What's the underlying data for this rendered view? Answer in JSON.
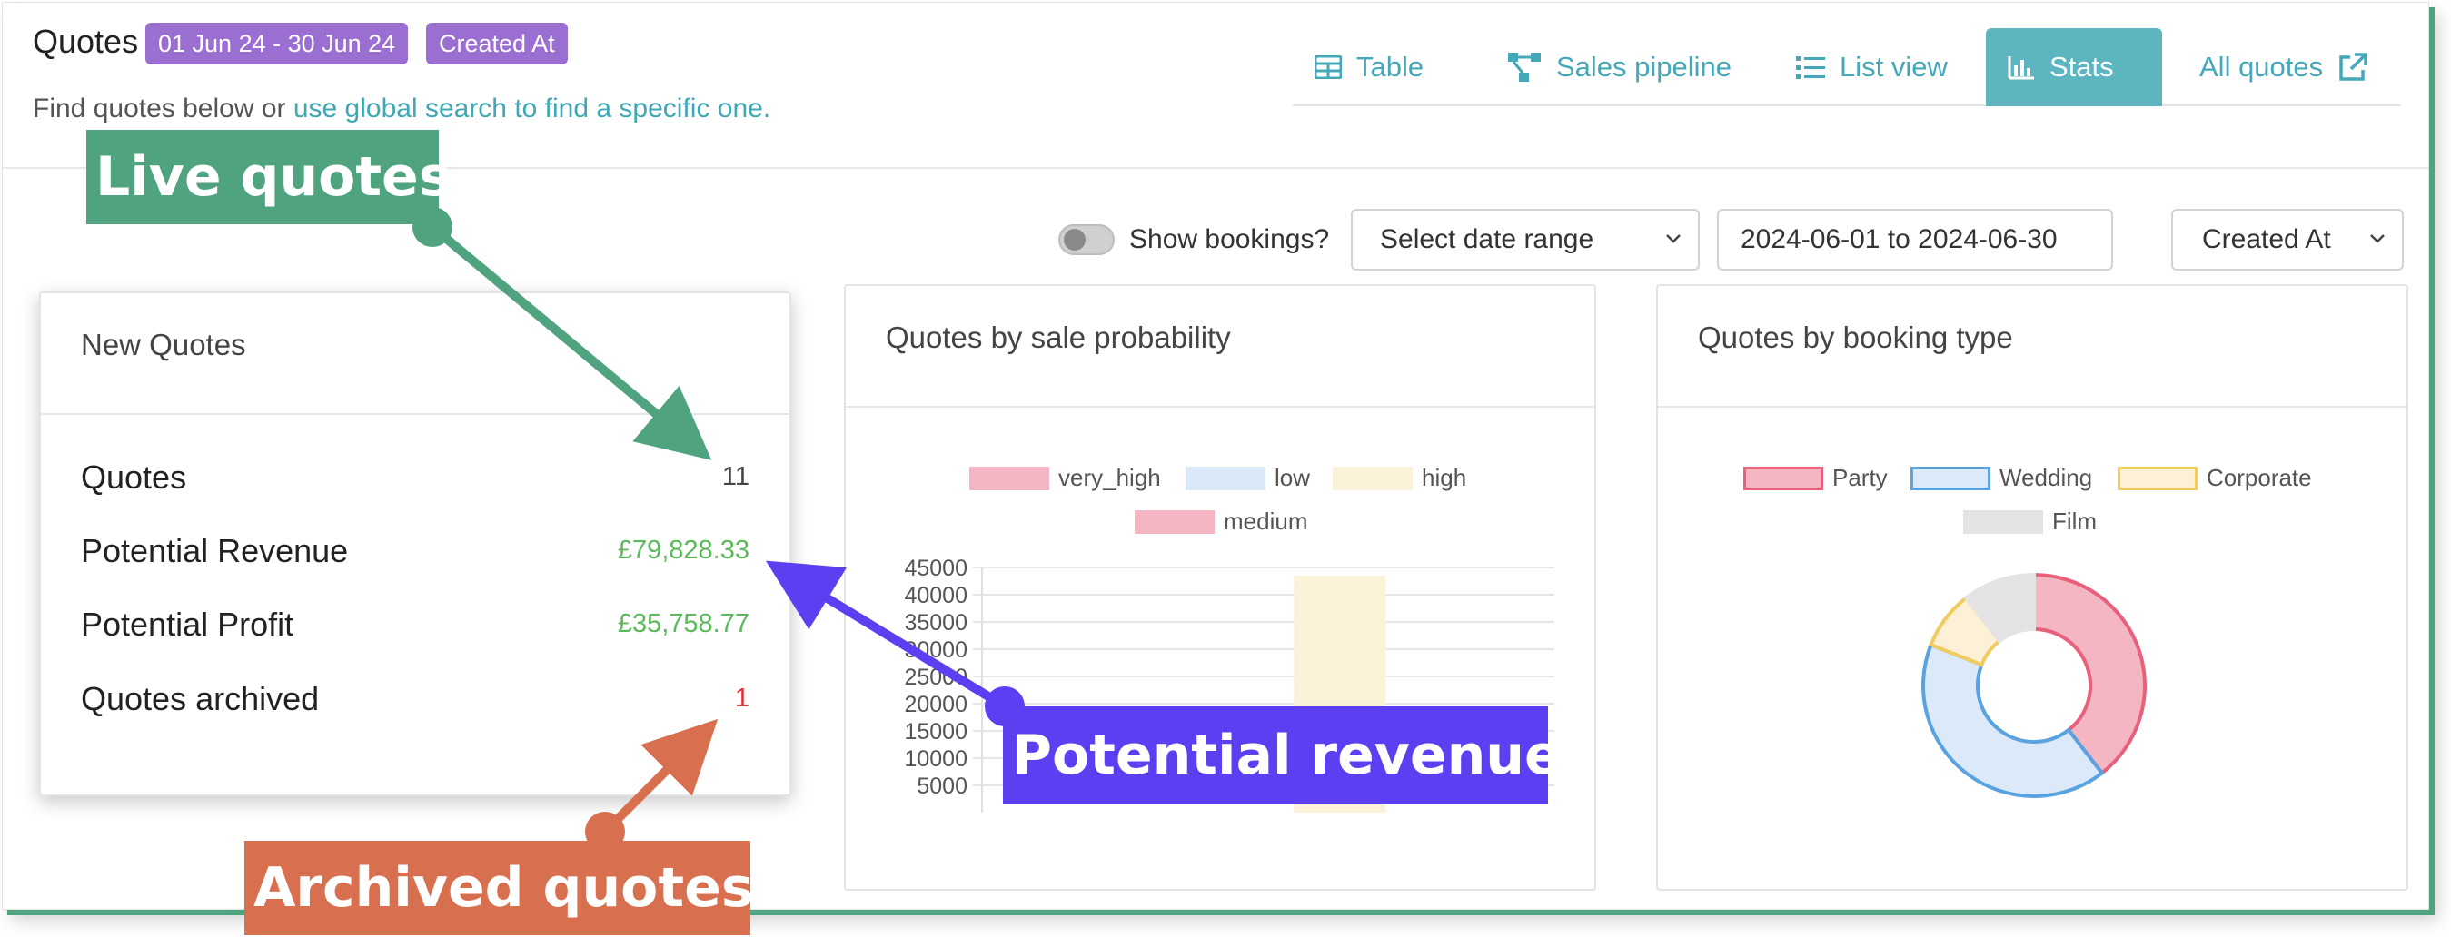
{
  "header": {
    "title": "Quotes",
    "date_badge": "01 Jun 24 - 30 Jun 24",
    "field_badge": "Created At",
    "subtitle_prefix": "Find quotes below or ",
    "subtitle_link": "use global search to find a specific one."
  },
  "nav": {
    "table": "Table",
    "sales_pipeline": "Sales pipeline",
    "list_view": "List view",
    "stats": "Stats",
    "all_quotes": "All quotes",
    "active": "Stats"
  },
  "filters": {
    "show_bookings_label": "Show bookings?",
    "show_bookings": false,
    "date_range_select": "Select date range",
    "date_range_value": "2024-06-01 to 2024-06-30",
    "date_field_select": "Created At"
  },
  "new_quotes": {
    "title": "New Quotes",
    "rows": [
      {
        "label": "Quotes",
        "value": "11",
        "color": "#444444"
      },
      {
        "label": "Potential Revenue",
        "value": "£79,828.33",
        "color": "#5cb85c"
      },
      {
        "label": "Potential Profit",
        "value": "£35,758.77",
        "color": "#5cb85c"
      },
      {
        "label": "Quotes archived",
        "value": "1",
        "color": "#e0343c"
      }
    ]
  },
  "chart_probability": {
    "title": "Quotes by sale probability",
    "legend": [
      {
        "label": "very_high",
        "color": "#f4b6c2"
      },
      {
        "label": "low",
        "color": "#d9e9f8"
      },
      {
        "label": "high",
        "color": "#fcf1d9"
      },
      {
        "label": "medium",
        "color": "#f4b6c2"
      }
    ],
    "yticks": [
      "45000",
      "40000",
      "35000",
      "30000",
      "25000",
      "20000",
      "15000",
      "10000",
      "5000"
    ]
  },
  "chart_booking": {
    "title": "Quotes by booking type",
    "legend": [
      {
        "label": "Party",
        "color": "#f4b6c2",
        "stroke": "#e8607a"
      },
      {
        "label": "Wedding",
        "color": "#dbe9f8",
        "stroke": "#5aa3e0"
      },
      {
        "label": "Corporate",
        "color": "#fcf1d6",
        "stroke": "#f0cc60"
      },
      {
        "label": "Film",
        "color": "#e4e4e4",
        "stroke": "#e4e4e4"
      }
    ]
  },
  "chart_data": [
    {
      "type": "bar",
      "title": "Quotes by sale probability",
      "categories": [
        "very_high",
        "low",
        "high",
        "medium"
      ],
      "series": [
        {
          "name": "very_high",
          "values": [
            0,
            0,
            0,
            0
          ]
        },
        {
          "name": "low",
          "values": [
            0,
            0,
            0,
            0
          ]
        },
        {
          "name": "high",
          "values": [
            0,
            0,
            43500,
            0
          ]
        },
        {
          "name": "medium",
          "values": [
            0,
            0,
            0,
            0
          ]
        }
      ],
      "ylim": [
        0,
        45000
      ],
      "grid": true,
      "legend_position": "top"
    },
    {
      "type": "pie",
      "title": "Quotes by booking type",
      "labels": [
        "Party",
        "Wedding",
        "Corporate",
        "Film"
      ],
      "values": [
        39.5,
        41.5,
        8.5,
        10.5
      ],
      "legend_position": "top"
    }
  ],
  "callouts": {
    "live": "Live quotes",
    "revenue": "Potential revenue",
    "archived": "Archived quotes"
  }
}
